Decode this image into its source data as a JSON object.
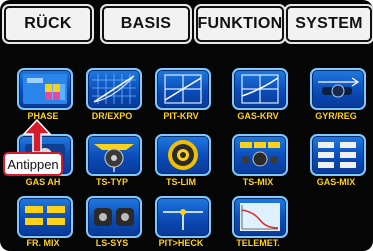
{
  "topbar": {
    "buttons": [
      "RÜCK",
      "BASIS",
      "FUNKTION",
      "SYSTEM"
    ]
  },
  "tiles": [
    {
      "label": "PHASE",
      "icon": "phase-icon"
    },
    {
      "label": "DR/EXPO",
      "icon": "dr-expo-icon"
    },
    {
      "label": "PIT-KRV",
      "icon": "pitch-curve-icon"
    },
    {
      "label": "GAS-KRV",
      "icon": "throttle-curve-icon"
    },
    {
      "label": "GYR/REG",
      "icon": "gyro-governor-icon"
    },
    {
      "label": "GAS AH",
      "icon": "throttle-hold-icon"
    },
    {
      "label": "TS-TYP",
      "icon": "swashplate-type-icon"
    },
    {
      "label": "TS-LIM",
      "icon": "swashplate-limit-icon"
    },
    {
      "label": "TS-MIX",
      "icon": "swashplate-mix-icon"
    },
    {
      "label": "GAS-MIX",
      "icon": "throttle-mix-icon"
    },
    {
      "label": "FR. MIX",
      "icon": "free-mix-icon"
    },
    {
      "label": "LS-SYS",
      "icon": "trainer-system-icon"
    },
    {
      "label": "PIT>HECK",
      "icon": "pitch-to-tail-icon"
    },
    {
      "label": "TELEMET.",
      "icon": "telemetry-icon"
    }
  ],
  "callout": {
    "text": "Antippen"
  },
  "colors": {
    "accent": "#ffd21a",
    "tile": "#1565d8",
    "callout_border": "#d61c2c"
  }
}
